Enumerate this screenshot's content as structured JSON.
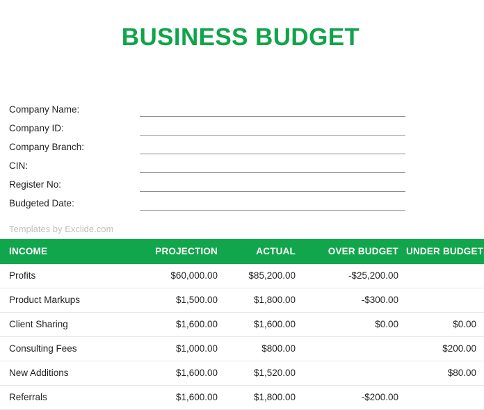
{
  "document": {
    "title": "BUSINESS BUDGET",
    "title_color": "#0fa44a",
    "accent_color": "#12a64c",
    "credit": "Templates by Exclide.com"
  },
  "form": {
    "fields": [
      {
        "label": "Company Name:",
        "value": ""
      },
      {
        "label": "Company ID:",
        "value": ""
      },
      {
        "label": "Company Branch:",
        "value": ""
      },
      {
        "label": "CIN:",
        "value": ""
      },
      {
        "label": "Register No:",
        "value": ""
      },
      {
        "label": "Budgeted Date:",
        "value": ""
      }
    ]
  },
  "table": {
    "headers": {
      "name": "INCOME",
      "projection": "PROJECTION",
      "actual": "ACTUAL",
      "over_budget": "OVER BUDGET",
      "under_budget": "UNDER BUDGET"
    },
    "rows": [
      {
        "name": "Profits",
        "projection": "$60,000.00",
        "actual": "$85,200.00",
        "over_budget": "-$25,200.00",
        "under_budget": ""
      },
      {
        "name": "Product Markups",
        "projection": "$1,500.00",
        "actual": "$1,800.00",
        "over_budget": "-$300.00",
        "under_budget": ""
      },
      {
        "name": "Client Sharing",
        "projection": "$1,600.00",
        "actual": "$1,600.00",
        "over_budget": "$0.00",
        "under_budget": "$0.00"
      },
      {
        "name": "Consulting Fees",
        "projection": "$1,000.00",
        "actual": "$800.00",
        "over_budget": "",
        "under_budget": "$200.00"
      },
      {
        "name": "New Additions",
        "projection": "$1,600.00",
        "actual": "$1,520.00",
        "over_budget": "",
        "under_budget": "$80.00"
      },
      {
        "name": "Referrals",
        "projection": "$1,600.00",
        "actual": "$1,800.00",
        "over_budget": "-$200.00",
        "under_budget": ""
      }
    ]
  }
}
